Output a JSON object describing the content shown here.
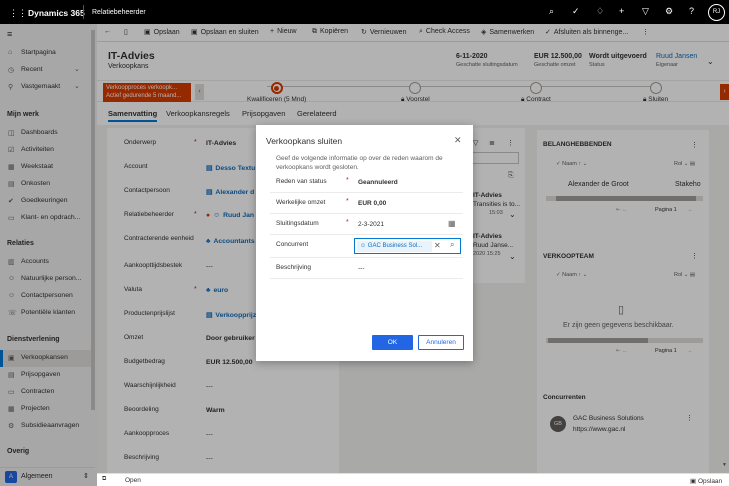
{
  "app": {
    "brand": "Dynamics 365",
    "module": "Relatiebeheerder",
    "user_initials": "RJ"
  },
  "sidebar": {
    "top_items": [
      {
        "label": "Startpagina",
        "icon": "home-icon"
      },
      {
        "label": "Recent",
        "icon": "clock-icon"
      },
      {
        "label": "Vastgemaakt",
        "icon": "pin-icon"
      }
    ],
    "sections": [
      {
        "title": "Mijn werk",
        "items": [
          "Dashboards",
          "Activiteiten",
          "Weekstaat",
          "Onkosten",
          "Goedkeuringen",
          "Klant- en opdrach..."
        ]
      },
      {
        "title": "Relaties",
        "items": [
          "Accounts",
          "Natuurlijke person...",
          "Contactpersonen",
          "Potentiële klanten"
        ]
      },
      {
        "title": "Dienstverlening",
        "items": [
          "Verkoopkansen",
          "Prijsopgaven",
          "Contracten",
          "Projecten",
          "Subsidieaanvragen"
        ]
      },
      {
        "title": "Overig",
        "items": []
      }
    ],
    "area": {
      "badge": "A",
      "label": "Algemeen"
    }
  },
  "commands": [
    {
      "label": "",
      "icon": "back-icon"
    },
    {
      "label": "",
      "icon": "page-icon"
    },
    {
      "label": "Opslaan",
      "icon": "save-icon"
    },
    {
      "label": "Opslaan en sluiten",
      "icon": "save-close-icon"
    },
    {
      "label": "Nieuw",
      "icon": "plus-icon"
    },
    {
      "label": "Kopiëren",
      "icon": "copy-icon"
    },
    {
      "label": "Vernieuwen",
      "icon": "refresh-icon"
    },
    {
      "label": "Check Access",
      "icon": "search-icon"
    },
    {
      "label": "Samenwerken",
      "icon": "teams-icon"
    },
    {
      "label": "Afsluiten als binnenge...",
      "icon": "check-icon"
    }
  ],
  "record": {
    "title": "IT-Advies",
    "type": "Verkoopkans",
    "header_fields": [
      {
        "value": "6-11-2020",
        "label": "Geschatte sluitingsdatum"
      },
      {
        "value": "EUR 12.500,00",
        "label": "Geschatte omzet"
      },
      {
        "value": "Wordt uitgevoerd",
        "label": "Status"
      },
      {
        "value": "Ruud Jansen",
        "label": "Eigenaar"
      }
    ]
  },
  "bpf": {
    "alert_line1": "Verkoopproces verkoopk...",
    "alert_line2": "Actief gedurende 5 maand...",
    "stages": [
      {
        "label": "Kwalificeren  (5 Mnd)",
        "active": true
      },
      {
        "label": "Voorstel",
        "active": false
      },
      {
        "label": "Contract",
        "active": false
      },
      {
        "label": "Sluiten",
        "active": false
      }
    ]
  },
  "tabs": [
    "Samenvatting",
    "Verkoopkansregels",
    "Prijsopgaven",
    "Gerelateerd"
  ],
  "form_fields": [
    {
      "label": "Onderwerp",
      "required": true,
      "value": "IT-Advies"
    },
    {
      "label": "Account",
      "required": false,
      "value": "Desso Textu"
    },
    {
      "label": "Contactpersoon",
      "required": false,
      "value": "Alexander d"
    },
    {
      "label": "Relatiebeheerder",
      "required": true,
      "value": "Ruud Jan"
    },
    {
      "label": "Contracterende eenheid",
      "required": false,
      "value": "Accountants"
    },
    {
      "label": "Aankoopttijdsbestek",
      "required": false,
      "value": "---"
    },
    {
      "label": "Valuta",
      "required": true,
      "value": "euro"
    },
    {
      "label": "Productenprijslijst",
      "required": false,
      "value": "Verkoopprijz"
    },
    {
      "label": "Omzet",
      "required": false,
      "value": "Door gebruiker"
    },
    {
      "label": "Budgetbedrag",
      "required": false,
      "value": "EUR 12.500,00"
    },
    {
      "label": "Waarschijnlijkheid",
      "required": false,
      "value": "---"
    },
    {
      "label": "Beoordeling",
      "required": false,
      "value": "Warm"
    },
    {
      "label": "Aankoopproces",
      "required": false,
      "value": "---"
    },
    {
      "label": "Beschrijving",
      "required": false,
      "value": "---"
    }
  ],
  "timeline": [
    {
      "line1": "IT-Advies",
      "line2": "Transities is to...",
      "time": "15:03"
    },
    {
      "line1": "IT-Advies",
      "line2": "Ruud Janse...",
      "time": "2020 15:25"
    }
  ],
  "stakeholders": {
    "title": "BELANGHEBBENDEN",
    "col_name": "Naam",
    "col_role": "Rol",
    "row_name": "Alexander de Groot",
    "row_role": "Stakeho",
    "page": "Pagina 1"
  },
  "team": {
    "title": "VERKOOPTEAM",
    "col_name": "Naam",
    "col_role": "Rol",
    "empty": "Er zijn geen gegevens beschikbaar.",
    "page": "Pagina 1"
  },
  "competitors": {
    "title": "Concurrenten",
    "initials": "GB",
    "name": "GAC Business Solutions",
    "url": "https://www.gac.nl"
  },
  "status_bar": {
    "left": "Open",
    "right": "Opslaan"
  },
  "dialog": {
    "title": "Verkoopkans sluiten",
    "description": "Geef de volgende informatie op over de reden waarom de verkoopkans wordt gesloten.",
    "fields": [
      {
        "label": "Reden van status",
        "required": true,
        "value": "Geannuleerd"
      },
      {
        "label": "Werkelijke omzet",
        "required": true,
        "value": "EUR 0,00"
      },
      {
        "label": "Sluitingsdatum",
        "required": true,
        "value": "2-3-2021"
      },
      {
        "label": "Concurrent",
        "required": false,
        "value": "GAC Business Sol..."
      },
      {
        "label": "Beschrijving",
        "required": false,
        "value": "---"
      }
    ],
    "ok_label": "OK",
    "cancel_label": "Annuleren"
  },
  "colors": {
    "accent": "#0078d4",
    "primary_button": "#2266e3",
    "alert": "#d83b01",
    "topbar": "#000000"
  }
}
